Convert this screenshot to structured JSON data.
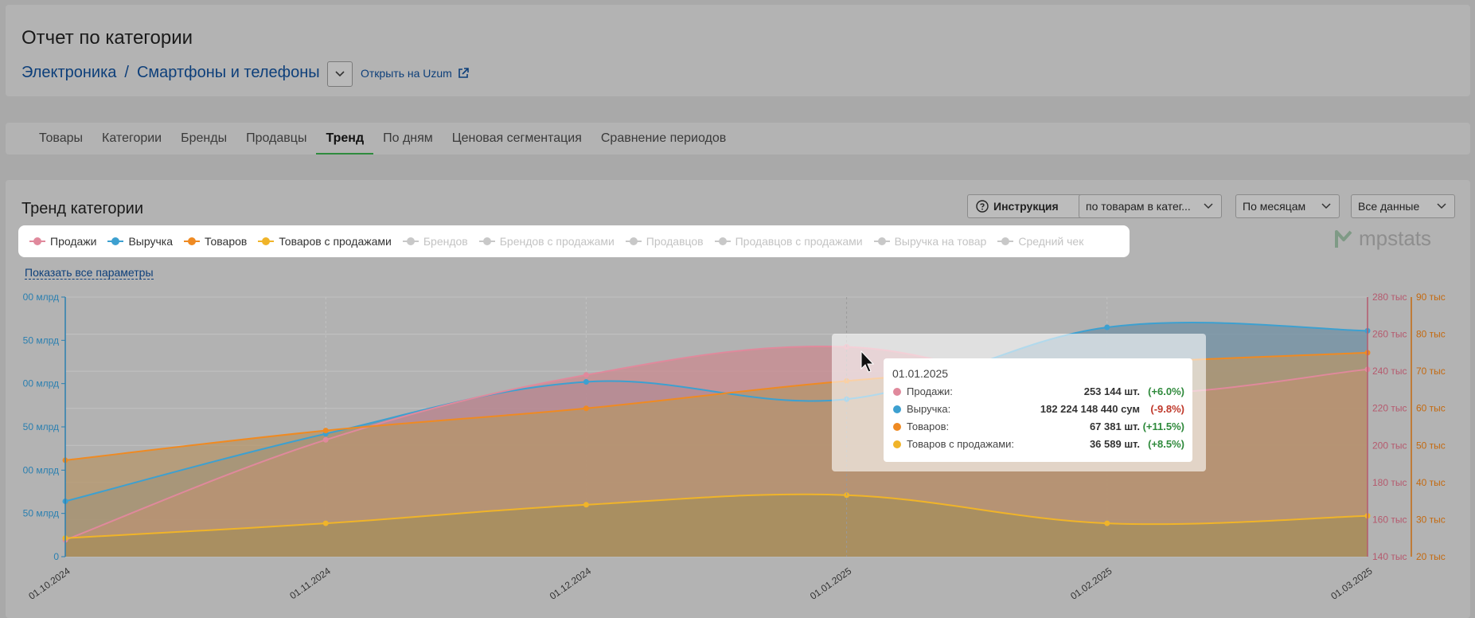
{
  "header": {
    "title": "Отчет по категории",
    "breadcrumb": [
      "Электроника",
      "Смартфоны и телефоны"
    ],
    "breadcrumb_sep": "/",
    "open_link": "Открыть на Uzum"
  },
  "tabs": [
    {
      "label": "Товары",
      "active": false
    },
    {
      "label": "Категории",
      "active": false
    },
    {
      "label": "Бренды",
      "active": false
    },
    {
      "label": "Продавцы",
      "active": false
    },
    {
      "label": "Тренд",
      "active": true
    },
    {
      "label": "По дням",
      "active": false
    },
    {
      "label": "Ценовая сегментация",
      "active": false
    },
    {
      "label": "Сравнение периодов",
      "active": false
    }
  ],
  "trend": {
    "title": "Тренд категории",
    "instruction_button": "Инструкция",
    "scope_select": "по товарам в катег...",
    "period_select": "По месяцам",
    "data_select": "Все данные",
    "show_all": "Показать все параметры",
    "brand": "mpstats"
  },
  "legend": [
    {
      "label": "Продажи",
      "color": "#e0899c",
      "active": true
    },
    {
      "label": "Выручка",
      "color": "#3da0d0",
      "active": true
    },
    {
      "label": "Товаров",
      "color": "#ef8a22",
      "active": true
    },
    {
      "label": "Товаров с продажами",
      "color": "#f0b429",
      "active": true
    },
    {
      "label": "Брендов",
      "color": "#c8c8c8",
      "active": false
    },
    {
      "label": "Брендов с продажами",
      "color": "#c8c8c8",
      "active": false
    },
    {
      "label": "Продавцов",
      "color": "#c8c8c8",
      "active": false
    },
    {
      "label": "Продавцов с продажами",
      "color": "#c8c8c8",
      "active": false
    },
    {
      "label": "Выручка на товар",
      "color": "#c8c8c8",
      "active": false
    },
    {
      "label": "Средний чек",
      "color": "#c8c8c8",
      "active": false
    }
  ],
  "chart_data": {
    "type": "area",
    "categories": [
      "01.10.2024",
      "01.11.2024",
      "01.12.2024",
      "01.01.2025",
      "01.02.2025",
      "01.03.2025"
    ],
    "axes": {
      "left": {
        "ticks": [
          "0",
          "50 млрд",
          "00 млрд",
          "50 млрд",
          "00 млрд",
          "50 млрд",
          "00 млрд"
        ],
        "color": "#2a7fb0"
      },
      "right_inner": {
        "ticks": [
          "140 тыс",
          "160 тыс",
          "180 тыс",
          "200 тыс",
          "220 тыс",
          "240 тыс",
          "260 тыс",
          "280 тыс"
        ],
        "color": "#b55a6e"
      },
      "right_outer": {
        "ticks": [
          "20 тыс",
          "30 тыс",
          "40 тыс",
          "50 тыс",
          "60 тыс",
          "70 тыс",
          "80 тыс",
          "90 тыс"
        ],
        "color": "#c46a10"
      }
    },
    "grid": true,
    "series": [
      {
        "name": "Продажи",
        "axis": "right_inner",
        "color": "#e0899c",
        "fill": "#c98a8f",
        "values": [
          149000,
          203000,
          238000,
          253144,
          228000,
          241000
        ]
      },
      {
        "name": "Выручка",
        "axis": "left",
        "color": "#3da0d0",
        "fill": "#6f8fa3",
        "values": [
          64,
          142,
          202,
          182,
          265,
          261
        ],
        "unit": "млрд"
      },
      {
        "name": "Товаров",
        "axis": "right_outer",
        "color": "#ef8a22",
        "fill": "#b5966a",
        "values": [
          46,
          54,
          60,
          67381,
          72,
          75
        ]
      },
      {
        "name": "Товаров с продажами",
        "axis": "right_outer",
        "color": "#f0b429",
        "fill": "#a48d5b",
        "values": [
          25,
          29,
          34,
          36589,
          29,
          31
        ]
      }
    ],
    "tooltip": {
      "date": "01.01.2025",
      "rows": [
        {
          "label": "Продажи:",
          "value": "253 144 шт.",
          "change": "(+6.0%)",
          "color": "#e0899c",
          "positive": true
        },
        {
          "label": "Выручка:",
          "value": "182 224 148 440 сум",
          "change": "(-9.8%)",
          "color": "#3da0d0",
          "positive": false
        },
        {
          "label": "Товаров:",
          "value": "67 381 шт.",
          "change": "(+11.5%)",
          "color": "#ef8a22",
          "positive": true
        },
        {
          "label": "Товаров с продажами:",
          "value": "36 589 шт.",
          "change": "(+8.5%)",
          "color": "#f0b429",
          "positive": true
        }
      ]
    }
  }
}
